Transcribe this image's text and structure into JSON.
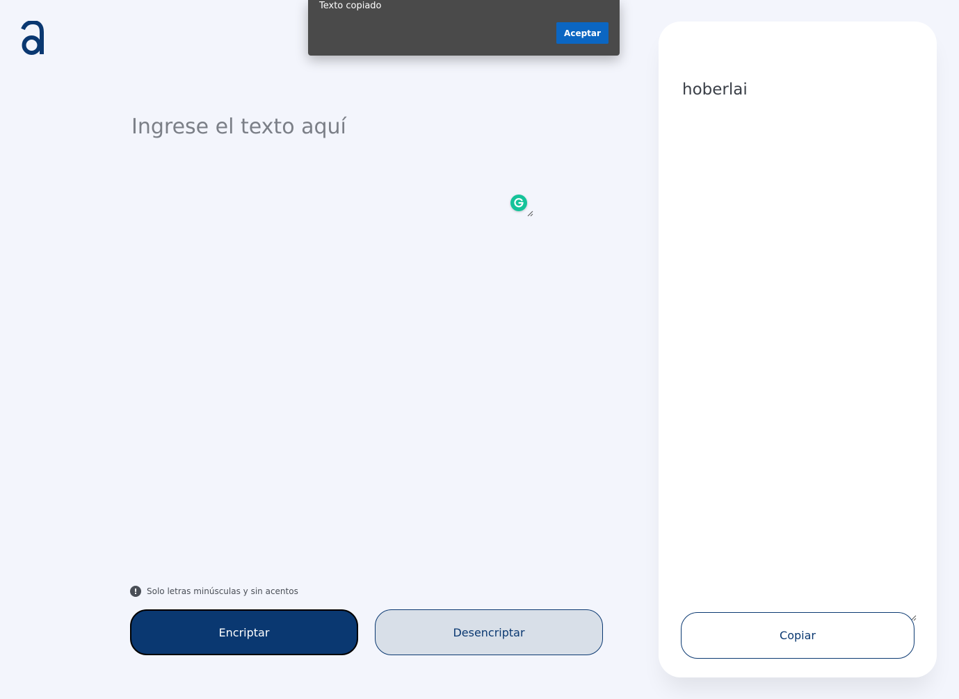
{
  "header": {
    "logo_icon": "alura-a-logo-icon",
    "logo_color": "#0a3871"
  },
  "dialog": {
    "message": "Texto copiado",
    "accept_label": "Aceptar",
    "accept_color": "#0b66c2"
  },
  "input": {
    "placeholder": "Ingrese el texto aquí",
    "value": ""
  },
  "info": {
    "icon": "exclamation-circle-icon",
    "text": "Solo letras minúsculas y sin acentos"
  },
  "actions": {
    "encrypt_label": "Encriptar",
    "decrypt_label": "Desencriptar",
    "primary_color": "#0a3871",
    "secondary_color": "#d8dfe8"
  },
  "output": {
    "text": "hoberlai",
    "copy_label": "Copiar"
  },
  "extensions": {
    "grammarly_icon": "grammarly-g-icon",
    "grammarly_color": "#15c39a"
  }
}
